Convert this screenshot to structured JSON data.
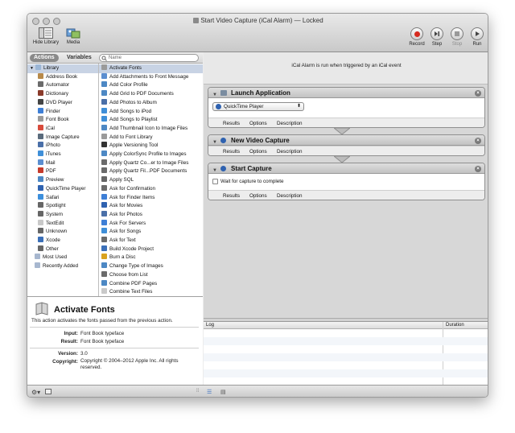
{
  "window": {
    "title": "Start Video Capture (iCal Alarm) — Locked"
  },
  "toolbar": {
    "hide_library": "Hide Library",
    "media": "Media",
    "record": "Record",
    "step": "Step",
    "stop": "Stop",
    "run": "Run"
  },
  "library": {
    "tab_actions": "Actions",
    "tab_variables": "Variables",
    "search_placeholder": "Name",
    "root": "Library",
    "items": [
      {
        "label": "Address Book",
        "color": "#b88a4a"
      },
      {
        "label": "Automator",
        "color": "#6b6b6b"
      },
      {
        "label": "Dictionary",
        "color": "#8a3a2a"
      },
      {
        "label": "DVD Player",
        "color": "#444444"
      },
      {
        "label": "Finder",
        "color": "#3e7fd6"
      },
      {
        "label": "Font Book",
        "color": "#9a9a9a"
      },
      {
        "label": "iCal",
        "color": "#d84b3c"
      },
      {
        "label": "Image Capture",
        "color": "#5a6b7c"
      },
      {
        "label": "iPhoto",
        "color": "#4a6fa8"
      },
      {
        "label": "iTunes",
        "color": "#3f8fd8"
      },
      {
        "label": "Mail",
        "color": "#5b8ed0"
      },
      {
        "label": "PDF",
        "color": "#c63b2b"
      },
      {
        "label": "Preview",
        "color": "#4d88c4"
      },
      {
        "label": "QuickTime Player",
        "color": "#2f62b0"
      },
      {
        "label": "Safari",
        "color": "#3c8fdc"
      },
      {
        "label": "Spotlight",
        "color": "#666666"
      },
      {
        "label": "System",
        "color": "#666666"
      },
      {
        "label": "TextEdit",
        "color": "#c9c9c9"
      },
      {
        "label": "Unknown",
        "color": "#666666"
      },
      {
        "label": "Xcode",
        "color": "#3b6fb8"
      },
      {
        "label": "Other",
        "color": "#666666"
      }
    ],
    "most_used": "Most Used",
    "recently_added": "Recently Added"
  },
  "actions": [
    "Activate Fonts",
    "Add Attachments to Front Message",
    "Add Color Profile",
    "Add Grid to PDF Documents",
    "Add Photos to Album",
    "Add Songs to iPod",
    "Add Songs to Playlist",
    "Add Thumbnail Icon to Image Files",
    "Add to Font Library",
    "Apple Versioning Tool",
    "Apply ColorSync Profile to Images",
    "Apply Quartz Co...er to Image Files",
    "Apply Quartz Fil...PDF Documents",
    "Apply SQL",
    "Ask for Confirmation",
    "Ask for Finder Items",
    "Ask for Movies",
    "Ask for Photos",
    "Ask For Servers",
    "Ask for Songs",
    "Ask for Text",
    "Build Xcode Project",
    "Burn a Disc",
    "Change Type of Images",
    "Choose from List",
    "Combine PDF Pages",
    "Combine Text Files"
  ],
  "action_colors": [
    "#9a9a9a",
    "#5b8ed0",
    "#4d88c4",
    "#4d88c4",
    "#4a6fa8",
    "#3f8fd8",
    "#3f8fd8",
    "#4d88c4",
    "#9a9a9a",
    "#333333",
    "#4d88c4",
    "#6b6b6b",
    "#6b6b6b",
    "#666666",
    "#6b6b6b",
    "#3e7fd6",
    "#2f62b0",
    "#4a6fa8",
    "#3e7fd6",
    "#3f8fd8",
    "#6b6b6b",
    "#3b6fb8",
    "#d9a21f",
    "#4d88c4",
    "#6b6b6b",
    "#4d88c4",
    "#c9c9c9"
  ],
  "detail": {
    "title": "Activate Fonts",
    "description": "This action activates the fonts passed from the previous action.",
    "input_label": "Input:",
    "input_value": "Font Book typeface",
    "result_label": "Result:",
    "result_value": "Font Book typeface",
    "version_label": "Version:",
    "version_value": "3.0",
    "copyright_label": "Copyright:",
    "copyright_value": "Copyright © 2004–2012 Apple Inc. All rights reserved."
  },
  "workflow": {
    "header_text": "iCal Alarm is run when triggered by an iCal event",
    "cards": [
      {
        "title": "Launch Application",
        "select_value": "QuickTime Player"
      },
      {
        "title": "New Video Capture"
      },
      {
        "title": "Start Capture",
        "checkbox_label": "Wait for capture to complete"
      }
    ],
    "tool_results": "Results",
    "tool_options": "Options",
    "tool_description": "Description"
  },
  "log": {
    "col_log": "Log",
    "col_duration": "Duration"
  }
}
